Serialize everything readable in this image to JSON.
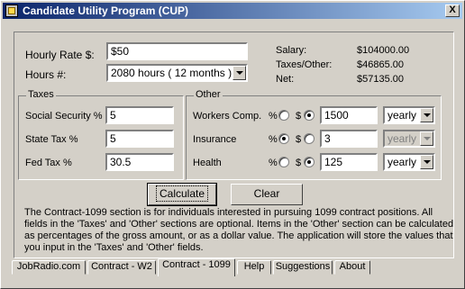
{
  "window": {
    "title": "Candidate Utility Program (CUP)",
    "close_label": "X"
  },
  "form": {
    "hourly_rate_label": "Hourly Rate $:",
    "hourly_rate_value": "$50",
    "hours_label": "Hours #:",
    "hours_value": "2080 hours ( 12 months )"
  },
  "summary": {
    "salary_label": "Salary:",
    "salary_value": "$104000.00",
    "taxes_label": "Taxes/Other:",
    "taxes_value": "$46865.00",
    "net_label": "Net:",
    "net_value": "$57135.00"
  },
  "taxes": {
    "title": "Taxes",
    "social_security_label": "Social Security %",
    "social_security_value": "5",
    "state_tax_label": "State Tax %",
    "state_tax_value": "5",
    "fed_tax_label": "Fed Tax %",
    "fed_tax_value": "30.5"
  },
  "other": {
    "title": "Other",
    "rows": [
      {
        "label": "Workers Comp.",
        "pct": "%",
        "dollar": "$",
        "mode": "dollar",
        "value": "1500",
        "period": "yearly",
        "period_enabled": true
      },
      {
        "label": "Insurance",
        "pct": "%",
        "dollar": "$",
        "mode": "percent",
        "value": "3",
        "period": "yearly",
        "period_enabled": false
      },
      {
        "label": "Health",
        "pct": "%",
        "dollar": "$",
        "mode": "dollar",
        "value": "125",
        "period": "yearly",
        "period_enabled": true
      }
    ]
  },
  "buttons": {
    "calculate": "Calculate",
    "clear": "Clear"
  },
  "description": "The Contract-1099 section is for individuals interested in pursuing 1099 contract positions.  All fields in the 'Taxes' and 'Other' sections are optional.  Items in the 'Other' section can be calculated as percentages of the gross amount, or as a dollar value.  The application will store the values that you input in the 'Taxes' and 'Other' fields.",
  "tabs": [
    {
      "label": "JobRadio.com",
      "active": false
    },
    {
      "label": "Contract - W2",
      "active": false
    },
    {
      "label": "Contract - 1099",
      "active": true
    },
    {
      "label": "Help",
      "active": false
    },
    {
      "label": "Suggestions",
      "active": false
    },
    {
      "label": "About",
      "active": false
    }
  ]
}
